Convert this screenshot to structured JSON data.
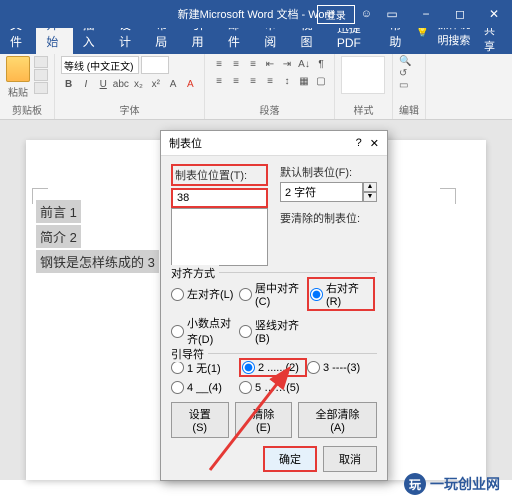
{
  "titlebar": {
    "title": "新建Microsoft Word 文档 - Word",
    "login": "登录",
    "face": "☺"
  },
  "tabs": {
    "file": "文件",
    "home": "开始",
    "insert": "插入",
    "design": "设计",
    "layout": "布局",
    "references": "引用",
    "mailings": "邮件",
    "review": "审阅",
    "view": "视图",
    "pdf": "迅捷PDF",
    "help": "帮助",
    "tell": "操作说明搜索",
    "share": "共享"
  },
  "ribbon": {
    "paste": "粘贴",
    "clipboard": "剪贴板",
    "font_name": "等线 (中文正文)",
    "font_size": "",
    "font_group": "字体",
    "para_group": "段落",
    "style_group": "样式",
    "edit_group": "编辑"
  },
  "doc": {
    "line1": "前言 1",
    "line2": "简介 2",
    "line3": "钢铁是怎样练成的 3"
  },
  "dialog": {
    "title": "制表位",
    "pos_label": "制表位位置(T):",
    "pos_value": "38",
    "default_label": "默认制表位(F):",
    "default_value": "2 字符",
    "clear_label": "要清除的制表位:",
    "align_label": "对齐方式",
    "align": {
      "left": "左对齐(L)",
      "center": "居中对齐(C)",
      "right": "右对齐(R)",
      "decimal": "小数点对齐(D)",
      "bar": "竖线对齐(B)"
    },
    "leader_label": "引导符",
    "leader": {
      "l1": "1 无(1)",
      "l2": "2 ......(2)",
      "l3": "3 ----(3)",
      "l4": "4 __(4)",
      "l5": "5 ……(5)"
    },
    "set": "设置(S)",
    "clear": "清除(E)",
    "clear_all": "全部清除(A)",
    "ok": "确定",
    "cancel": "取消"
  },
  "watermark": "一玩创业网"
}
